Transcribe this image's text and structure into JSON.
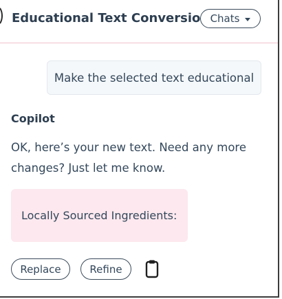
{
  "header": {
    "title": "Educational Text Conversion",
    "chats_label": "Chats"
  },
  "conversation": {
    "user_message": "Make the selected text educational",
    "assistant_name": "Copilot",
    "assistant_message": "OK, here’s your new text. Need any more changes? Just let me know.",
    "result_text": "Locally Sourced Ingredients:"
  },
  "actions": {
    "replace_label": "Replace",
    "refine_label": "Refine",
    "copy_icon": "clipboard-icon"
  },
  "colors": {
    "card_background": "#fce8ee",
    "header_divider": "#f2c3cb",
    "text": "#33475b"
  }
}
